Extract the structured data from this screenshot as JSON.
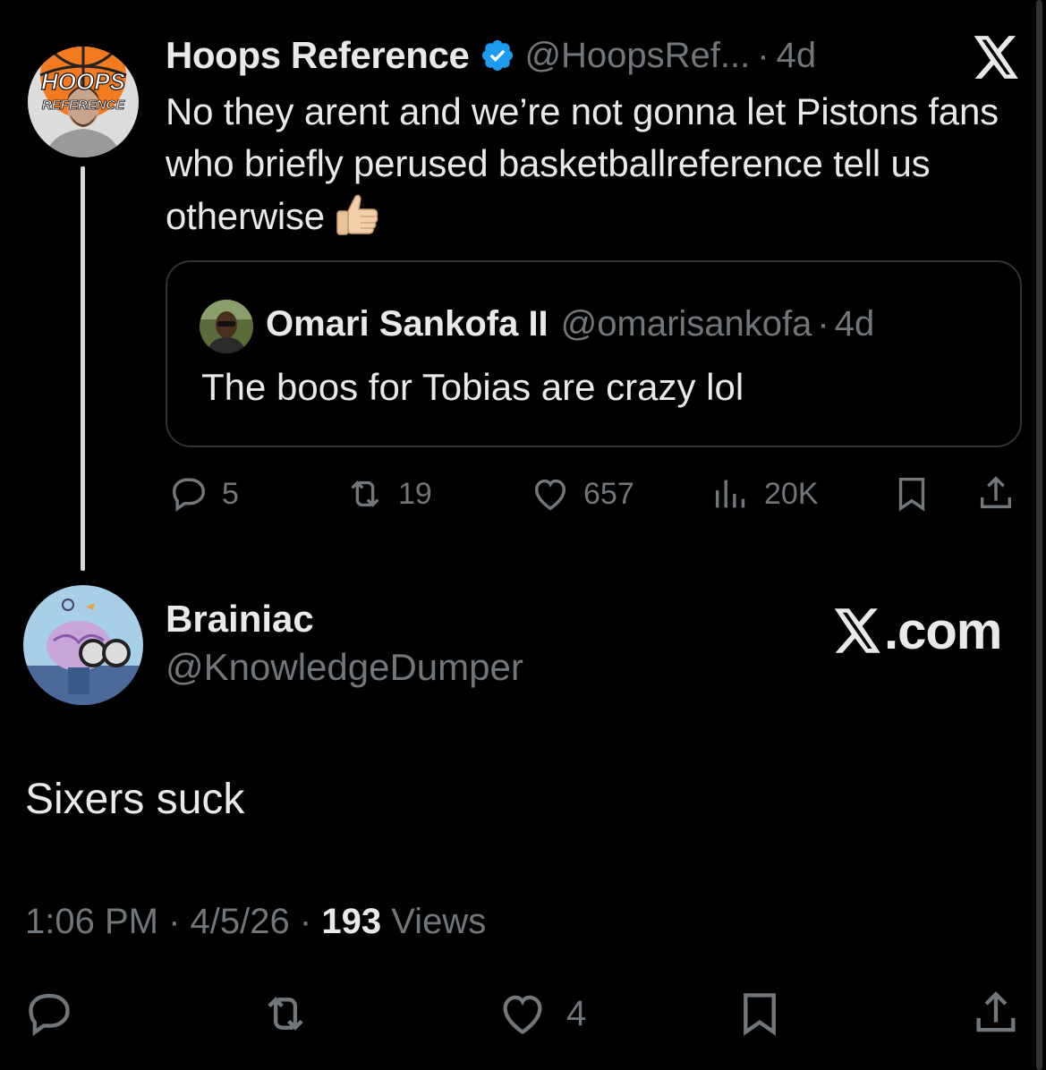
{
  "parent": {
    "avatar_logo_text_1": "HOOPS",
    "avatar_logo_text_2": "REFERENCE",
    "name": "Hoops Reference",
    "handle": "@HoopsRef...",
    "dot": "·",
    "time": "4d",
    "text": "No they arent and we’re not gonna let Pistons fans who briefly perused basketballreference tell us otherwise",
    "emoji": "thumbs-up-icon",
    "quote": {
      "name": "Omari Sankofa II",
      "handle": "@omarisankofa",
      "dot": "·",
      "time": "4d",
      "text": "The boos for Tobias are crazy lol"
    },
    "actions": {
      "replies": "5",
      "reposts": "19",
      "likes": "657",
      "views": "20K"
    }
  },
  "reply": {
    "name": "Brainiac",
    "handle": "@KnowledgeDumper",
    "brand": ".com",
    "text": "Sixers suck",
    "timestamp": "1:06 PM",
    "date": "4/5/26",
    "sep": "·",
    "views_count": "193",
    "views_label": "Views",
    "likes": "4"
  },
  "colors": {
    "background": "#000000",
    "text_primary": "#e7e9ea",
    "text_secondary": "#71767b",
    "border": "#2f3336",
    "verified": "#1d9bf0"
  }
}
